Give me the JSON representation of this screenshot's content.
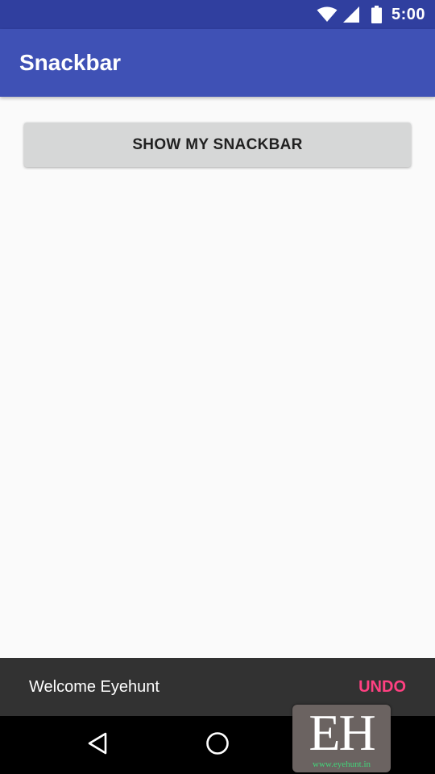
{
  "status_bar": {
    "time": "5:00",
    "icons": [
      "wifi-icon",
      "signal-icon",
      "battery-icon"
    ],
    "color": "#303f9f"
  },
  "app_bar": {
    "title": "Snackbar",
    "color": "#3f51b5"
  },
  "main": {
    "button_label": "SHOW MY SNACKBAR"
  },
  "snackbar": {
    "message": "Welcome Eyehunt",
    "action_label": "UNDO",
    "action_color": "#ff4081",
    "background": "#323232"
  },
  "navigation_bar": {
    "buttons": [
      "back-icon",
      "home-icon",
      "recents-icon"
    ]
  },
  "watermark": {
    "letters": "EH",
    "url": "www.eyehunt.in"
  }
}
